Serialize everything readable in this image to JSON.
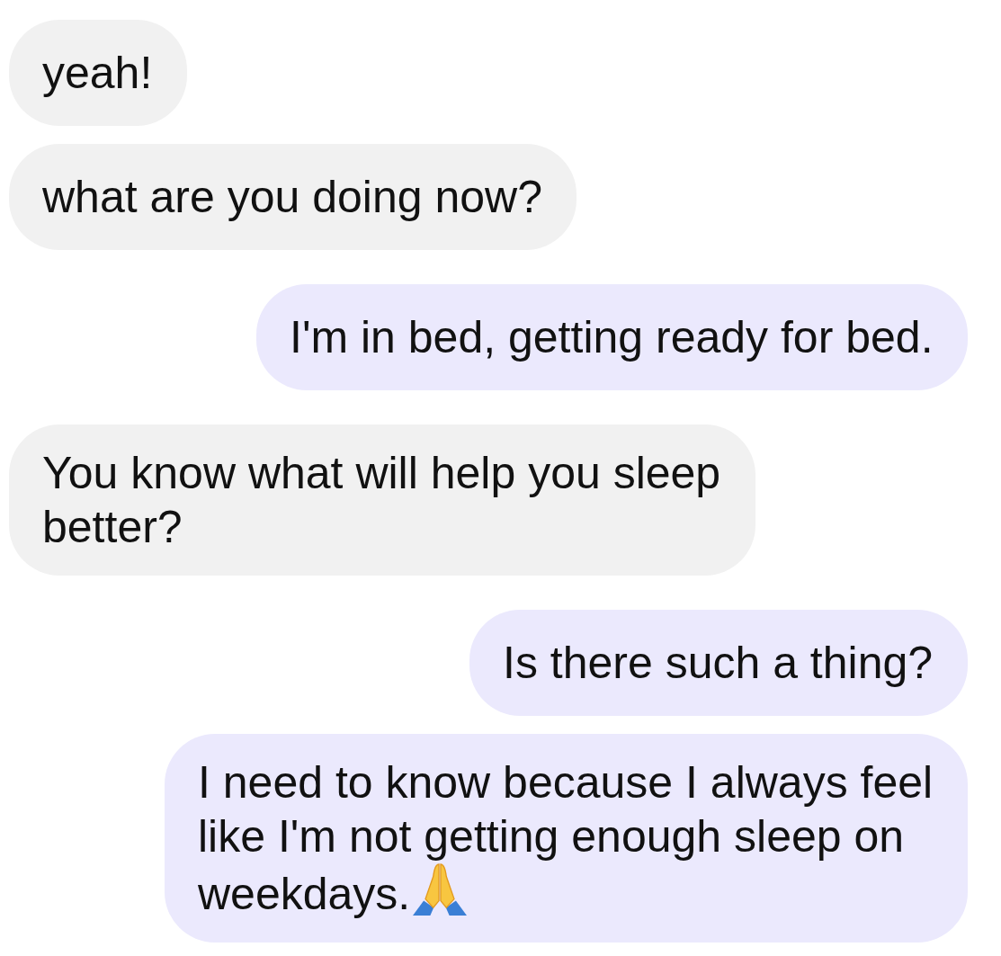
{
  "messages": [
    {
      "kind": "received",
      "text": "yeah!"
    },
    {
      "kind": "received",
      "text": "what are you doing now?"
    },
    {
      "kind": "sent",
      "text": "I'm in bed, getting ready for bed."
    },
    {
      "kind": "received",
      "text": "You know what will help you sleep better?"
    },
    {
      "kind": "sent",
      "text": "Is there such a thing?"
    },
    {
      "kind": "sent",
      "text": "I need to know because I always feel like I'm not getting enough sleep on weekdays.",
      "trailing_emoji": true
    }
  ]
}
